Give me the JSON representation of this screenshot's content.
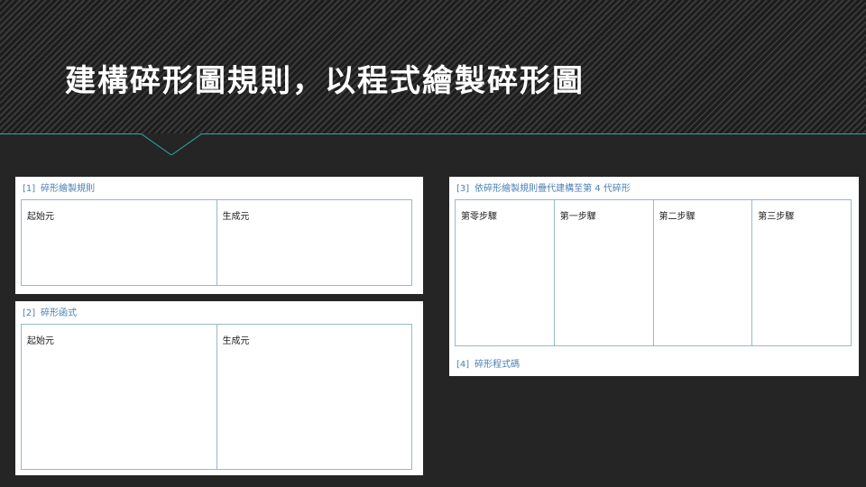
{
  "header": {
    "title": "建構碎形圖規則，以程式繪製碎形圖"
  },
  "panels": {
    "rules": {
      "number": "[1]",
      "title": "碎形繪製規則",
      "columns": [
        "起始元",
        "生成元"
      ]
    },
    "function": {
      "number": "[2]",
      "title": "碎形函式",
      "columns": [
        "起始元",
        "生成元"
      ]
    },
    "iteration": {
      "number": "[3]",
      "title": "依碎形繪製規則疊代建構至第 4 代碎形",
      "columns": [
        "第零步驟",
        "第一步驟",
        "第二步驟",
        "第三步驟"
      ]
    },
    "code": {
      "number": "[4]",
      "title": "碎形程式碼"
    }
  },
  "colors": {
    "accent": "#2fa8a8",
    "panel_title": "#4a7fb5",
    "grid_border": "#9ab7cf",
    "background": "#252525"
  }
}
